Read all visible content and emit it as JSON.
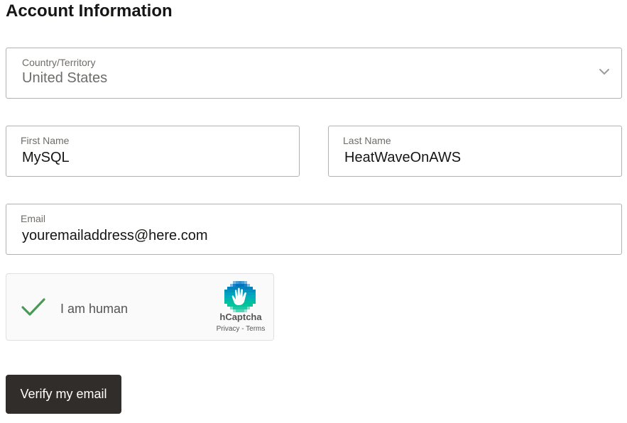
{
  "page": {
    "title": "Account Information"
  },
  "country": {
    "label": "Country/Territory",
    "value": "United States"
  },
  "first_name": {
    "label": "First Name",
    "value": "MySQL"
  },
  "last_name": {
    "label": "Last Name",
    "value": "HeatWaveOnAWS"
  },
  "email": {
    "label": "Email",
    "value": "youremailaddress@here.com"
  },
  "captcha": {
    "label": "I am human",
    "brand": "hCaptcha",
    "privacy": "Privacy",
    "separator": " - ",
    "terms": "Terms",
    "check_color": "#4a9a56",
    "check_icon": "checkmark-icon",
    "logo_icon": "hcaptcha-hand-logo"
  },
  "actions": {
    "verify_label": "Verify my email"
  },
  "colors": {
    "button_bg": "#312d2a",
    "border": "#b3b1ae",
    "label_text": "#6f6d6a"
  }
}
